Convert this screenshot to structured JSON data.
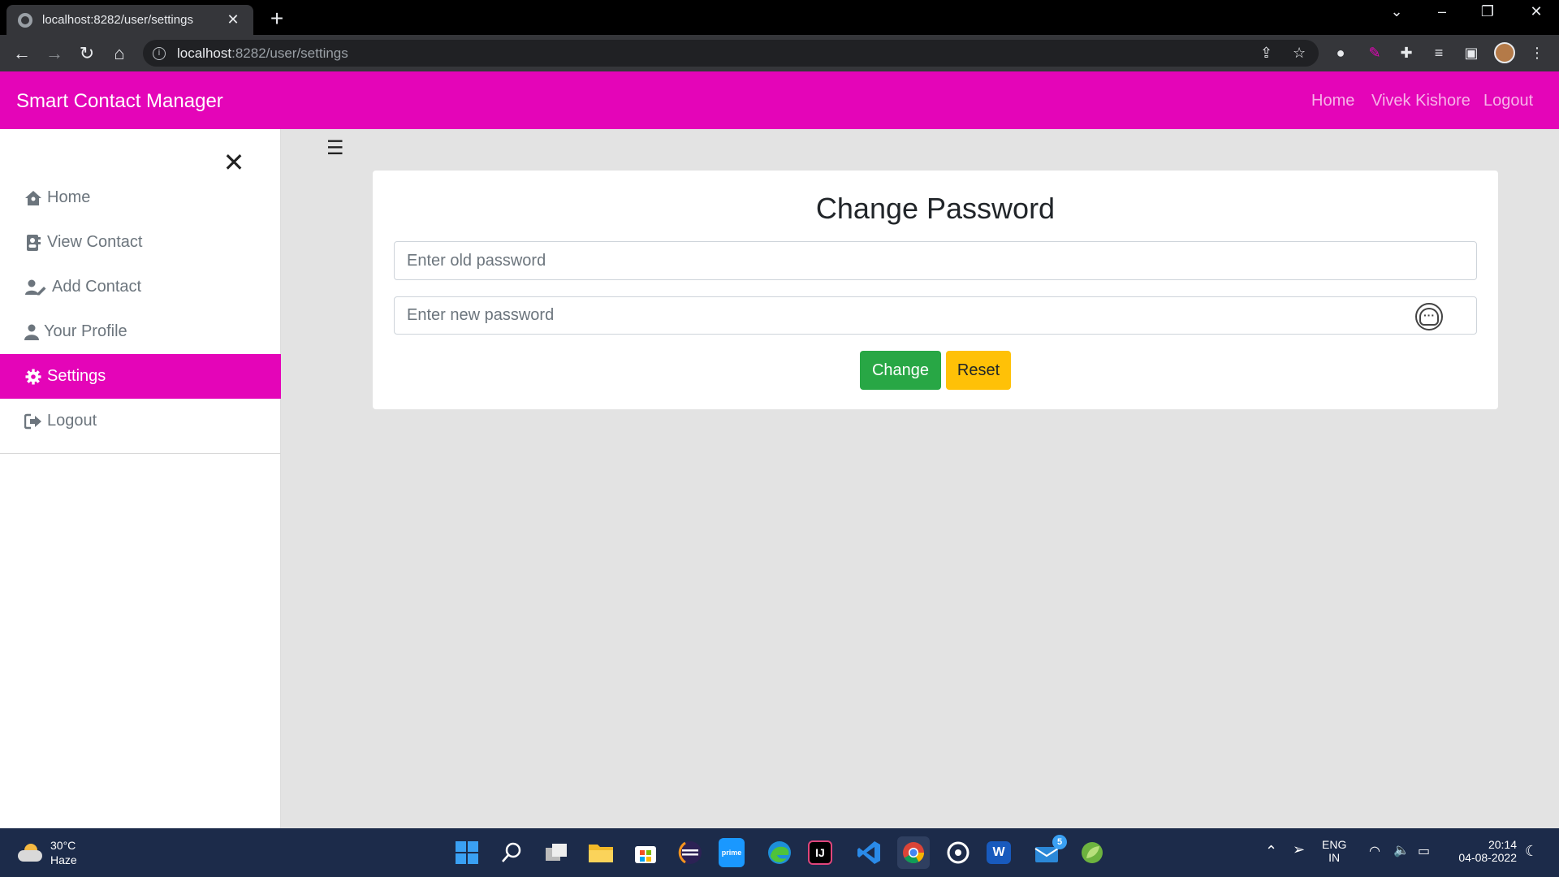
{
  "browser": {
    "tab_title": "localhost:8282/user/settings",
    "url_host": "localhost",
    "url_path": ":8282/user/settings"
  },
  "navbar": {
    "brand": "Smart Contact Manager",
    "links": [
      "Home",
      "Vivek Kishore",
      "Logout"
    ],
    "color": "#e405b8"
  },
  "sidebar": {
    "items": [
      {
        "label": "Home",
        "icon": "home-icon"
      },
      {
        "label": "View Contact",
        "icon": "address-book-icon"
      },
      {
        "label": "Add Contact",
        "icon": "user-edit-icon"
      },
      {
        "label": "Your Profile",
        "icon": "user-icon"
      },
      {
        "label": "Settings",
        "icon": "gear-icon",
        "active": true
      },
      {
        "label": "Logout",
        "icon": "logout-icon"
      }
    ]
  },
  "form": {
    "title": "Change Password",
    "old_password_placeholder": "Enter old password",
    "new_password_placeholder": "Enter new password",
    "change_label": "Change",
    "reset_label": "Reset"
  },
  "taskbar": {
    "temperature": "30°C",
    "weather": "Haze",
    "language": "ENG",
    "region": "IN",
    "time": "20:14",
    "date": "04-08-2022",
    "mail_badge": "5"
  }
}
